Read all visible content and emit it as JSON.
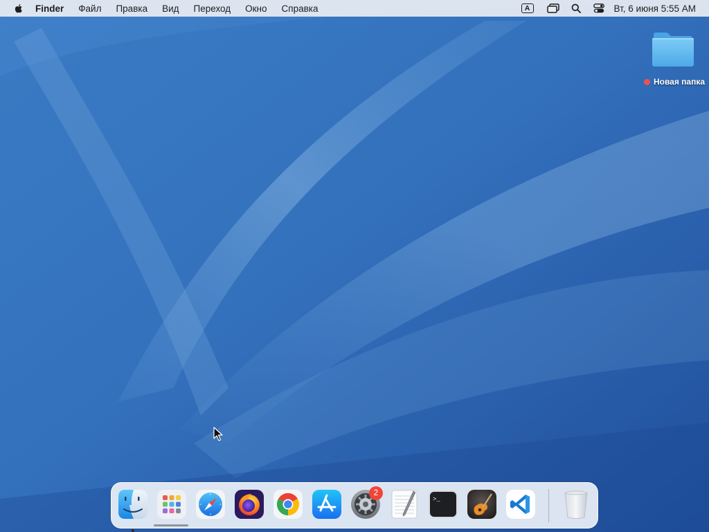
{
  "menubar": {
    "app_name": "Finder",
    "items": [
      "Файл",
      "Правка",
      "Вид",
      "Переход",
      "Окно",
      "Справка"
    ],
    "input_source": "A",
    "clock": "Вт, 6 июня  5:55 AM",
    "icons": [
      "apple-logo-icon",
      "input-source-icon",
      "screen-mirroring-icon",
      "spotlight-search-icon",
      "control-center-icon"
    ]
  },
  "desktop": {
    "folder": {
      "label": "Новая папка",
      "tag_color": "#ef5150",
      "icon": "folder-icon"
    }
  },
  "dock": {
    "items": [
      {
        "name": "finder",
        "icon": "finder-icon",
        "running": true
      },
      {
        "name": "launchpad",
        "icon": "launchpad-icon"
      },
      {
        "name": "safari",
        "icon": "safari-icon"
      },
      {
        "name": "firefox",
        "icon": "firefox-icon"
      },
      {
        "name": "chrome",
        "icon": "chrome-icon"
      },
      {
        "name": "app-store",
        "icon": "app-store-icon"
      },
      {
        "name": "system-preferences",
        "icon": "system-preferences-icon",
        "badge": "2"
      },
      {
        "name": "textedit",
        "icon": "textedit-icon"
      },
      {
        "name": "terminal",
        "icon": "terminal-icon"
      },
      {
        "name": "garageband",
        "icon": "garageband-icon"
      },
      {
        "name": "vscode",
        "icon": "vscode-icon"
      },
      {
        "name": "trash",
        "icon": "trash-icon"
      }
    ]
  },
  "colors": {
    "wallpaper_base": "#2d63ad",
    "menubar_bg": "#e8ecf3",
    "badge": "#ef4638",
    "folder": "#5cb7ee"
  }
}
